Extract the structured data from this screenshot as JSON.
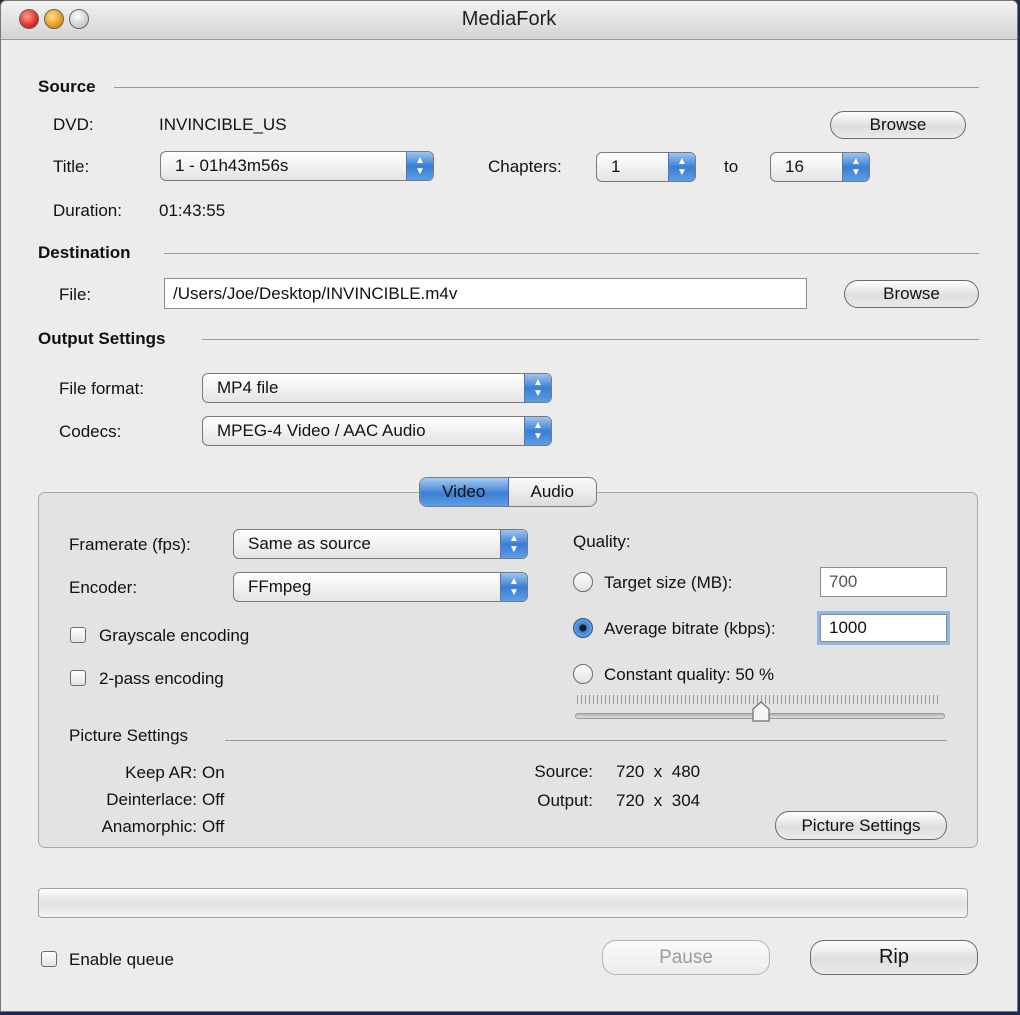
{
  "window": {
    "title": "MediaFork"
  },
  "source": {
    "heading": "Source",
    "dvd_label": "DVD:",
    "dvd_value": "INVINCIBLE_US",
    "browse_label": "Browse",
    "title_label": "Title:",
    "title_value": "1 - 01h43m56s",
    "chapters_label": "Chapters:",
    "chapter_from": "1",
    "to_label": "to",
    "chapter_to": "16",
    "duration_label": "Duration:",
    "duration_value": "01:43:55"
  },
  "destination": {
    "heading": "Destination",
    "file_label": "File:",
    "file_value": "/Users/Joe/Desktop/INVINCIBLE.m4v",
    "browse_label": "Browse"
  },
  "output": {
    "heading": "Output Settings",
    "format_label": "File format:",
    "format_value": "MP4 file",
    "codecs_label": "Codecs:",
    "codecs_value": "MPEG-4 Video / AAC Audio"
  },
  "tabs": {
    "video": "Video",
    "audio": "Audio",
    "selected": "Video"
  },
  "video": {
    "framerate_label": "Framerate (fps):",
    "framerate_value": "Same as source",
    "encoder_label": "Encoder:",
    "encoder_value": "FFmpeg",
    "grayscale_label": "Grayscale encoding",
    "grayscale_checked": false,
    "twopass_label": "2-pass encoding",
    "twopass_checked": false
  },
  "quality": {
    "label": "Quality:",
    "target_label": "Target size (MB):",
    "target_value": "700",
    "bitrate_label": "Average bitrate (kbps):",
    "bitrate_value": "1000",
    "constant_label": "Constant quality: 50 %",
    "selected": "bitrate",
    "slider_percent": 50
  },
  "picture": {
    "heading": "Picture Settings",
    "keep_ar_label": "Keep AR:",
    "keep_ar_value": "On",
    "deinterlace_label": "Deinterlace:",
    "deinterlace_value": "Off",
    "anamorphic_label": "Anamorphic:",
    "anamorphic_value": "Off",
    "source_label": "Source:",
    "source_value": "720  x  480",
    "output_label": "Output:",
    "output_value": "720  x  304",
    "button_label": "Picture Settings"
  },
  "footer": {
    "queue_label": "Enable queue",
    "queue_checked": false,
    "pause_label": "Pause",
    "rip_label": "Rip"
  },
  "icons": {
    "popup": "up-down-arrows-icon"
  },
  "colors": {
    "accent": "#3b7fd4",
    "window": "#ececec"
  }
}
